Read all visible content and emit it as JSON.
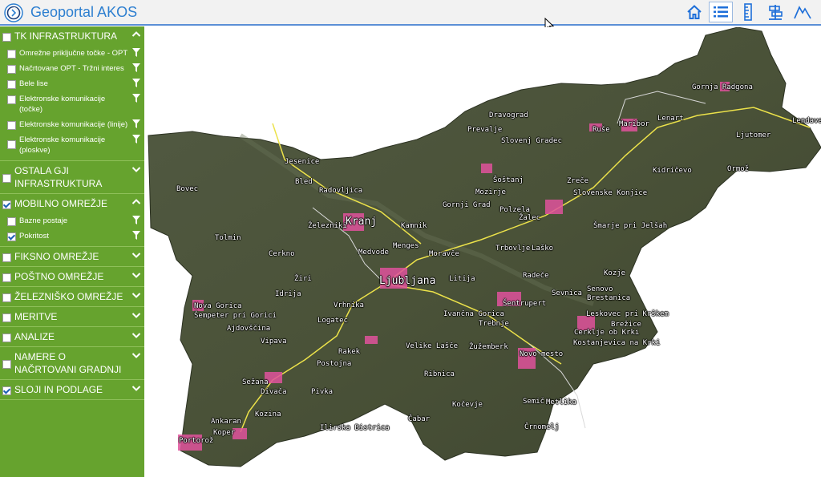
{
  "header": {
    "title": "Geoportal AKOS",
    "accent": "#2d7fd0",
    "toolbar": [
      {
        "name": "home-button",
        "icon": "home-icon"
      },
      {
        "name": "layer-list-button",
        "icon": "list-icon",
        "active": true
      },
      {
        "name": "measure-button",
        "icon": "ruler-icon"
      },
      {
        "name": "legend-button",
        "icon": "legend-icon"
      },
      {
        "name": "profile-button",
        "icon": "profile-icon"
      }
    ]
  },
  "sidebar": {
    "background": "#66a32e",
    "groups": [
      {
        "label": "TK INFRASTRUKTURA",
        "checked": false,
        "expanded": true,
        "layers": [
          {
            "label": "Omrežne priključne točke - OPT",
            "checked": false
          },
          {
            "label": "Načrtovane OPT - Tržni interes",
            "checked": false
          },
          {
            "label": "Bele lise",
            "checked": false
          },
          {
            "label": "Elektronske komunikacije (točke)",
            "checked": false
          },
          {
            "label": "Elektronske komunikacije (linije)",
            "checked": false
          },
          {
            "label": "Elektronske komunikacije (ploskve)",
            "checked": false
          }
        ]
      },
      {
        "label": "OSTALA GJI INFRASTRUKTURA",
        "checked": false,
        "expanded": false
      },
      {
        "label": "MOBILNO OMREŽJE",
        "checked": true,
        "expanded": true,
        "layers": [
          {
            "label": "Bazne postaje",
            "checked": false
          },
          {
            "label": "Pokritost",
            "checked": true
          }
        ]
      },
      {
        "label": "FIKSNO OMREŽJE",
        "checked": false,
        "expanded": false
      },
      {
        "label": "POŠTNO OMREŽJE",
        "checked": false,
        "expanded": false
      },
      {
        "label": "ŽELEZNIŠKO OMREŽJE",
        "checked": false,
        "expanded": false
      },
      {
        "label": "MERITVE",
        "checked": false,
        "expanded": false
      },
      {
        "label": "ANALIZE",
        "checked": false,
        "expanded": false
      },
      {
        "label": "NAMERE O NAČRTOVANI GRADNJI",
        "checked": false,
        "expanded": false
      },
      {
        "label": "SLOJI IN PODLAGE",
        "checked": true,
        "expanded": false
      }
    ]
  },
  "map": {
    "coverage_color": "#e0529c",
    "places": [
      "Gornja Radgona",
      "Lendava",
      "Dravograd",
      "Maribor",
      "Lenart",
      "Prevalje",
      "Ruše",
      "Ljutomer",
      "Slovenj Gradec",
      "Jesenice",
      "Kidričevo",
      "Ormož",
      "Bled",
      "Šoštanj",
      "Zreče",
      "Bovec",
      "Radovljica",
      "Mozirje",
      "Slovenske Konjice",
      "Gornji Grad",
      "Polzela",
      "Žalec",
      "Železniki",
      "Kranj",
      "Kamnik",
      "Šmarje pri Jelšah",
      "Tolmin",
      "Menges",
      "Trbovlje",
      "Laško",
      "Cerkno",
      "Medvode",
      "Moravče",
      "Kozje",
      "Ljubljana",
      "Litija",
      "Radeče",
      "Žiri",
      "Sevnica",
      "Senovo",
      "Brestanica",
      "Idrija",
      "Nova Gorica",
      "Vrhnika",
      "Šentrupert",
      "Šempeter pri Gorici",
      "Ivančna Gorica",
      "Leskovec pri Krškem",
      "Ajdovščina",
      "Logatec",
      "Trebnje",
      "Brežice",
      "Cerklje ob Krki",
      "Vipava",
      "Velike Lašče",
      "Žužemberk",
      "Kostanjevica na Krki",
      "Rakek",
      "Novo mesto",
      "Postojna",
      "Ribnica",
      "Sežana",
      "Divača",
      "Pivka",
      "Semič",
      "Metlika",
      "Kočevje",
      "Kozina",
      "Ankaran",
      "Čabar",
      "Koper",
      "Črnomelj",
      "Ilirska Bistrica",
      "Portorož"
    ]
  }
}
